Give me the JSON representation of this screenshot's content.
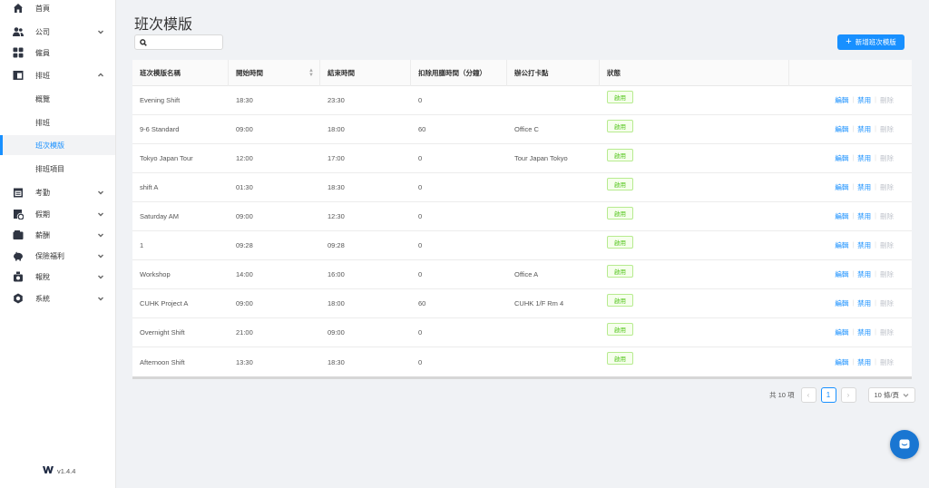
{
  "sidebar": {
    "items": [
      {
        "label": "首頁",
        "icon": "home-icon"
      },
      {
        "label": "公司",
        "icon": "company-icon"
      },
      {
        "label": "僱員",
        "icon": "employee-icon"
      },
      {
        "label": "排班",
        "icon": "schedule-icon"
      },
      {
        "label": "考勤",
        "icon": "attendance-icon"
      },
      {
        "label": "假期",
        "icon": "leave-icon"
      },
      {
        "label": "薪酬",
        "icon": "payroll-icon"
      },
      {
        "label": "保險福利",
        "icon": "insurance-icon"
      },
      {
        "label": "報稅",
        "icon": "tax-icon"
      },
      {
        "label": "系統",
        "icon": "settings-icon"
      }
    ],
    "sub_items": [
      "概覽",
      "排班",
      "班次模版",
      "排班項目"
    ],
    "version": "v1.4.4"
  },
  "page": {
    "title": "班次模版",
    "search_placeholder": "",
    "add_button": "新增班次模版"
  },
  "table": {
    "headers": [
      "班次模版名稱",
      "開始時間",
      "結束時間",
      "扣除用膳時間（分鐘）",
      "辦公打卡點",
      "狀態",
      ""
    ],
    "status_label": "啟用",
    "actions": {
      "edit": "編輯",
      "disable": "禁用",
      "delete": "刪除"
    },
    "rows": [
      {
        "name": "Evening Shift",
        "start": "18:30",
        "end": "23:30",
        "meal": "0",
        "location": ""
      },
      {
        "name": "9-6 Standard",
        "start": "09:00",
        "end": "18:00",
        "meal": "60",
        "location": "Office C"
      },
      {
        "name": "Tokyo Japan Tour",
        "start": "12:00",
        "end": "17:00",
        "meal": "0",
        "location": "Tour Japan Tokyo"
      },
      {
        "name": "shift A",
        "start": "01:30",
        "end": "18:30",
        "meal": "0",
        "location": ""
      },
      {
        "name": "Saturday AM",
        "start": "09:00",
        "end": "12:30",
        "meal": "0",
        "location": ""
      },
      {
        "name": "1",
        "start": "09:28",
        "end": "09:28",
        "meal": "0",
        "location": ""
      },
      {
        "name": "Workshop",
        "start": "14:00",
        "end": "16:00",
        "meal": "0",
        "location": "Office A"
      },
      {
        "name": "CUHK Project A",
        "start": "09:00",
        "end": "18:00",
        "meal": "60",
        "location": "CUHK 1/F Rm 4"
      },
      {
        "name": "Overnight Shift",
        "start": "21:00",
        "end": "09:00",
        "meal": "0",
        "location": ""
      },
      {
        "name": "Afternoon Shift",
        "start": "13:30",
        "end": "18:30",
        "meal": "0",
        "location": ""
      }
    ]
  },
  "pagination": {
    "total": "共 10 項",
    "current_page": "1",
    "page_size": "10 條/頁"
  },
  "colors": {
    "accent": "#1890ff",
    "status": "#52c41a"
  }
}
